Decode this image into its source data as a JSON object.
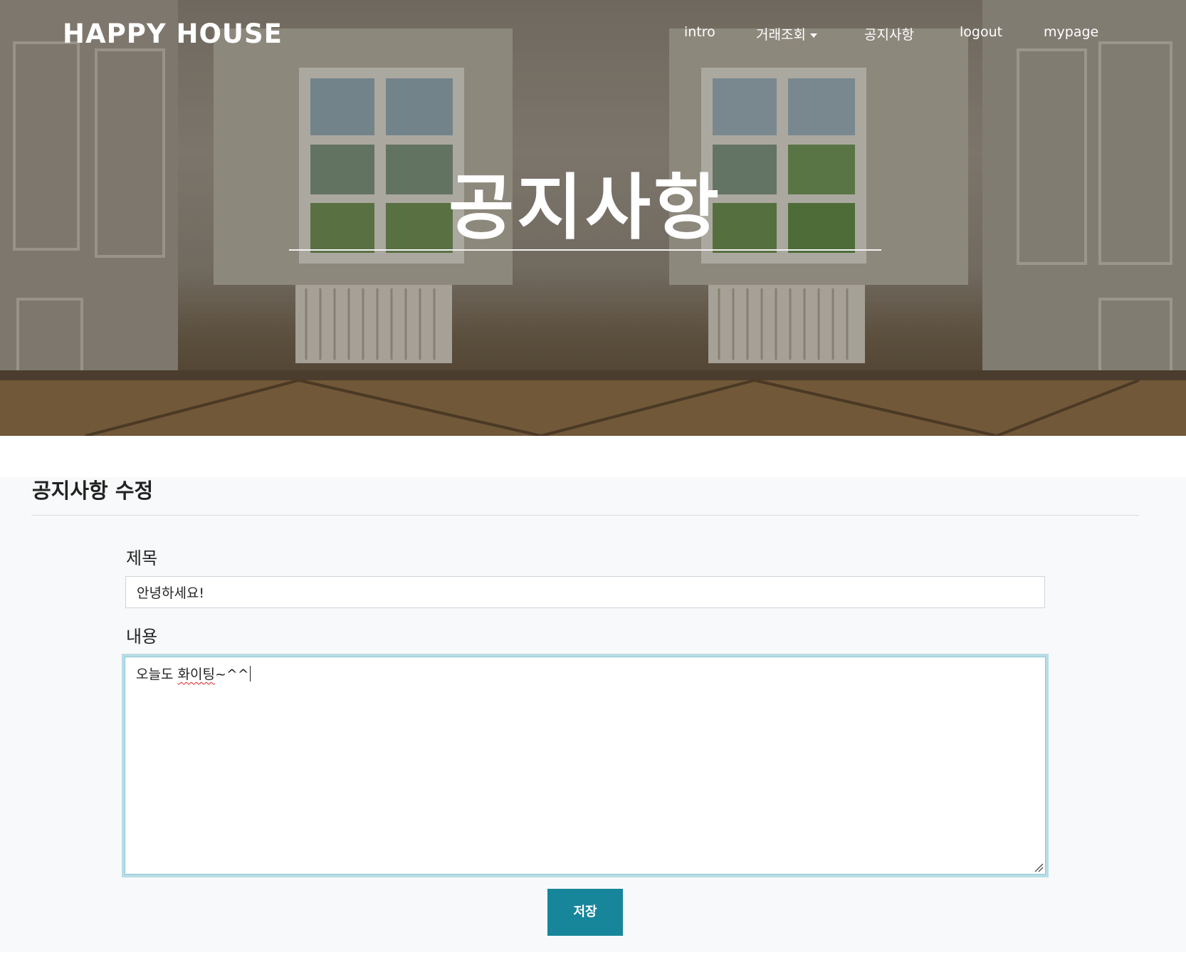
{
  "navbar": {
    "brand": "HAPPY HOUSE",
    "items": [
      {
        "label": "intro"
      },
      {
        "label": "거래조회"
      },
      {
        "label": "공지사항"
      },
      {
        "label": "logout"
      },
      {
        "label": "mypage"
      }
    ]
  },
  "hero": {
    "title": "공지사항"
  },
  "page": {
    "section_title": "공지사항 수정"
  },
  "form": {
    "title_label": "제목",
    "title_value": "안녕하세요!",
    "content_label": "내용",
    "content_parts": [
      "오늘도 ",
      "화이팅",
      "~^^"
    ],
    "save_label": "저장"
  },
  "colors": {
    "primary_button": "#17869b",
    "focus_ring": "#b7dde6",
    "panel_bg": "#f8f9fa"
  },
  "icons": {
    "dropdown": "caret-down-icon",
    "resize": "resize-handle-icon"
  }
}
